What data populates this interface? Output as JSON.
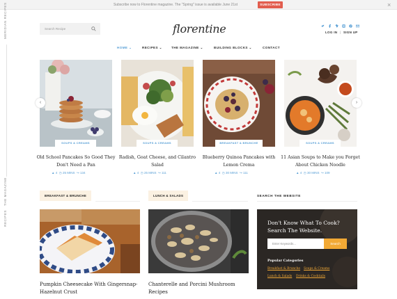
{
  "top_bar": {
    "message": "Subscribe now to Florentine magazine. The \"Spring\" issue is available June 21st",
    "subscribe_label": "SUBSCRIBE",
    "close_glyph": "×"
  },
  "side": {
    "top_label": "MERIDIAN RECIPES",
    "bottom_labels": [
      "THE MAGAZINE",
      "RECIPES"
    ]
  },
  "header": {
    "search_placeholder": "Search Recipe",
    "logo_text": "florentine",
    "social_icons": [
      "twitter-icon",
      "facebook-icon",
      "vimeo-icon",
      "instagram-icon",
      "pinterest-icon",
      "mail-icon"
    ],
    "login_label": "LOG IN",
    "signup_label": "SIGN UP",
    "auth_separator": "|"
  },
  "nav": {
    "items": [
      {
        "label": "HOME",
        "active": true
      },
      {
        "label": "RECIPES",
        "active": false
      },
      {
        "label": "THE MAGAZINE",
        "active": false
      },
      {
        "label": "BUILDING BLOCKS",
        "active": false
      },
      {
        "label": "CONTACT",
        "active": false
      }
    ]
  },
  "carousel": {
    "prev_glyph": "‹",
    "next_glyph": "›",
    "cards": [
      {
        "tag": "SOUPS & CREAMS",
        "title": "Old School Pancakes So Good They Don't Need a Pan",
        "comments": "4",
        "time": "25 MINS",
        "shares": "134"
      },
      {
        "tag": "SOUPS & CREAMS",
        "title": "Radish, Goat Cheese, and Cilantro Salad",
        "comments": "4",
        "time": "25 MINS",
        "shares": "111"
      },
      {
        "tag": "BREAKFAST & BRUNCHE",
        "title": "Blueberry Quinoa Pancakes with Lemon Crema",
        "comments": "4",
        "time": "30 MINS",
        "shares": "111"
      },
      {
        "tag": "SOUPS & CREAMS",
        "title": "11 Asian Soups to Make you Forget About Chicken Noodle",
        "comments": "4",
        "time": "30 MINS",
        "shares": "109"
      }
    ]
  },
  "sections": {
    "breakfast": {
      "label": "BREAKFAST & BRUNCHE",
      "post_title": "Pumpkin Cheesecake With Gingersnap-Hazelnut Crust"
    },
    "lunch": {
      "label": "LUNCH & SALADS",
      "post_title": "Chanterelle and Porcini Mushroom Recipes"
    },
    "search": {
      "label": "SEARCH THE WEBSITE",
      "widget_title": "Don't Know What To Cook? Search The Website.",
      "input_placeholder": "Enter Keywords...",
      "button_label": "Search",
      "popular_label": "Popular Categories",
      "categories": [
        "Breakfast & Brunche",
        "Soups & Creams",
        "Lunch & Salads",
        "Drinks & Cocktails"
      ]
    }
  },
  "colors": {
    "accent_blue": "#5aa0d6",
    "subscribe_red": "#e25d4e",
    "button_orange": "#f2a935",
    "section_tag_bg": "#fbf1e2",
    "widget_bg": "#2b2724"
  }
}
